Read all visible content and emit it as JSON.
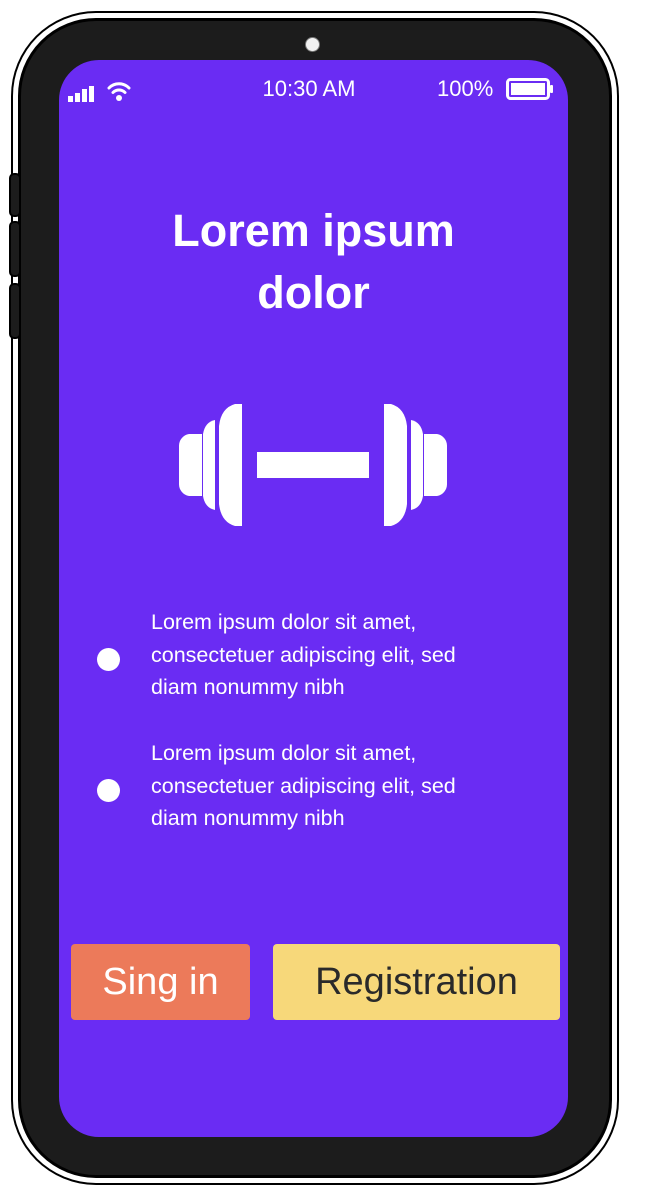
{
  "colors": {
    "screen_background": "#6a2cf3",
    "signin_button": "#ec7a5a",
    "registration_button": "#f7d87a"
  },
  "status_bar": {
    "time": "10:30 AM",
    "battery_percent": "100%",
    "icons": [
      "signal-icon",
      "wifi-icon",
      "battery-icon"
    ]
  },
  "main": {
    "title": "Lorem ipsum\ndolor",
    "hero_icon": "dumbbell-icon",
    "bullets": [
      {
        "text": "Lorem ipsum dolor sit amet,\nconsectetuer adipiscing elit, sed\ndiam nonummy nibh"
      },
      {
        "text": "Lorem ipsum dolor sit amet,\nconsectetuer adipiscing elit, sed\ndiam nonummy nibh"
      }
    ]
  },
  "actions": {
    "signin_label": "Sing in",
    "registration_label": "Registration"
  }
}
